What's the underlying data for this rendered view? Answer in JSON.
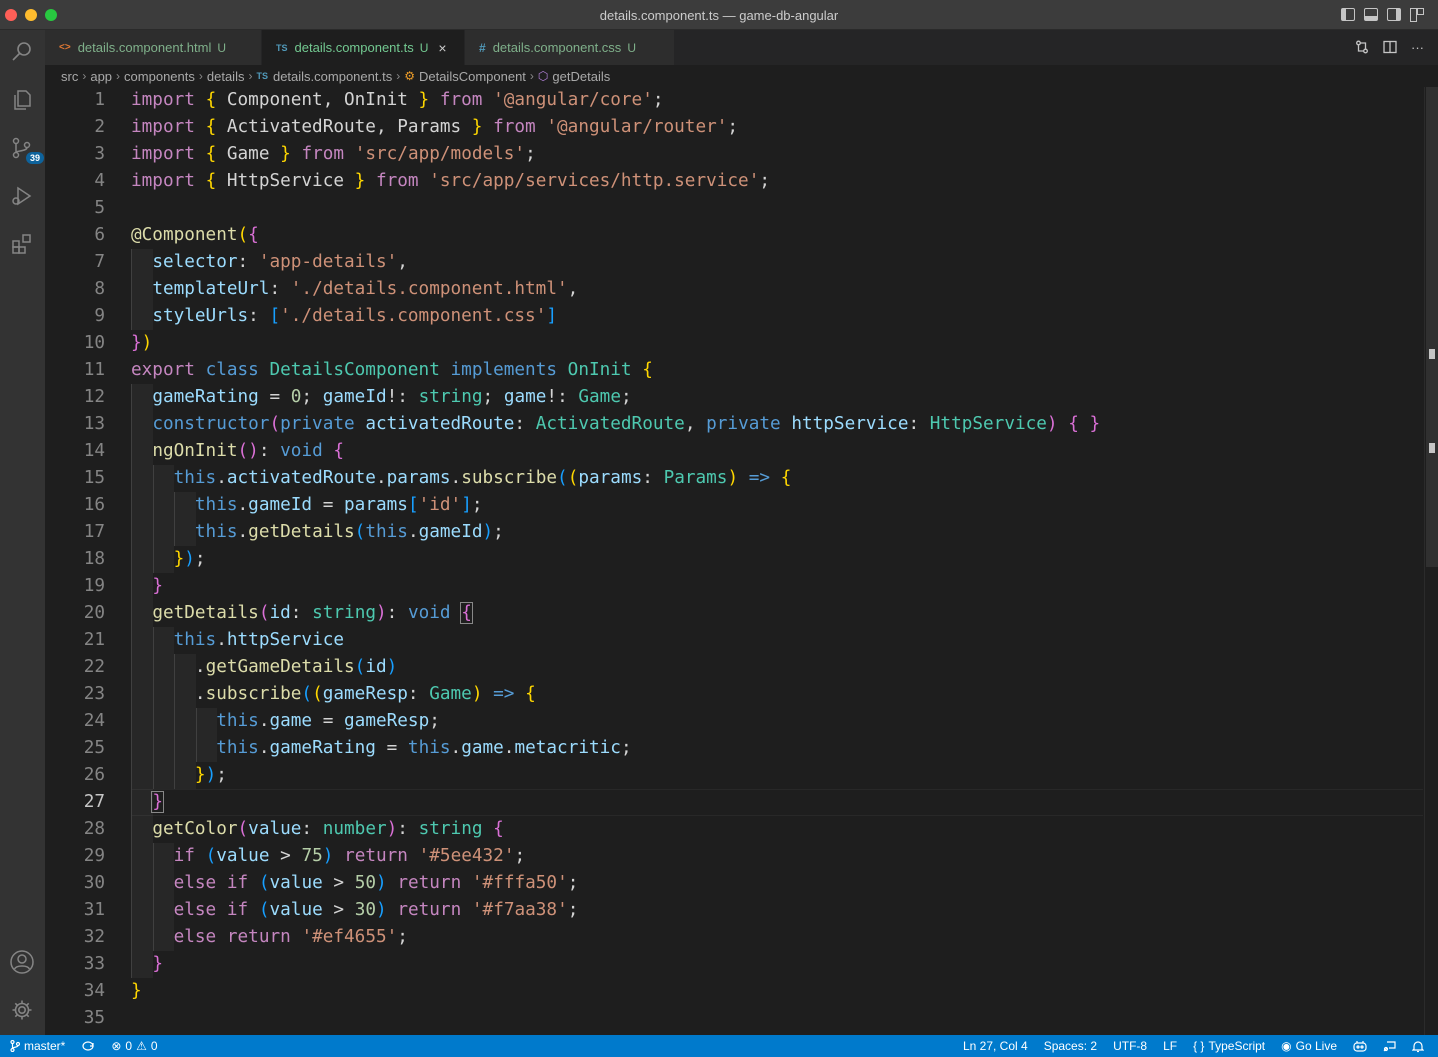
{
  "window": {
    "title": "details.component.ts — game-db-angular"
  },
  "activity": {
    "source_control_badge": "39"
  },
  "tabs": [
    {
      "icon": "<>",
      "label": "details.component.html",
      "status": "U"
    },
    {
      "icon": "TS",
      "label": "details.component.ts",
      "status": "U",
      "close": "×"
    },
    {
      "icon": "#",
      "label": "details.component.css",
      "status": "U"
    }
  ],
  "tab_actions": {
    "more": "···"
  },
  "breadcrumb": {
    "items": [
      "src",
      "app",
      "components",
      "details",
      "details.component.ts",
      "DetailsComponent",
      "getDetails"
    ],
    "ts_icon": "TS"
  },
  "editor": {
    "line_numbers": [
      "1",
      "2",
      "3",
      "4",
      "5",
      "6",
      "7",
      "8",
      "9",
      "10",
      "11",
      "12",
      "13",
      "14",
      "15",
      "16",
      "17",
      "18",
      "19",
      "20",
      "21",
      "22",
      "23",
      "24",
      "25",
      "26",
      "27",
      "28",
      "29",
      "30",
      "31",
      "32",
      "33",
      "34",
      "35"
    ],
    "current_line": "27"
  },
  "statusbar": {
    "branch": "master*",
    "errors": "0",
    "warnings": "0",
    "position": "Ln 27, Col 4",
    "spaces": "Spaces: 2",
    "encoding": "UTF-8",
    "eol": "LF",
    "language": "TypeScript",
    "language_icon": "{ }",
    "golive": "Go Live"
  },
  "code_tokens": [
    [
      "import",
      " ",
      "{",
      " Component, OnInit ",
      "}",
      " ",
      "from",
      " ",
      "'@angular/core'",
      ";"
    ],
    [
      "import",
      " ",
      "{",
      " ActivatedRoute, Params ",
      "}",
      " ",
      "from",
      " ",
      "'@angular/router'",
      ";"
    ],
    [
      "import",
      " ",
      "{",
      " Game ",
      "}",
      " ",
      "from",
      " ",
      "'src/app/models'",
      ";"
    ],
    [
      "import",
      " ",
      "{",
      " HttpService ",
      "}",
      " ",
      "from",
      " ",
      "'src/app/services/http.service'",
      ";"
    ],
    [],
    [
      "@",
      "Component",
      "(",
      "{"
    ],
    [
      "  ",
      "selector",
      ": ",
      "'app-details'",
      ","
    ],
    [
      "  ",
      "templateUrl",
      ": ",
      "'./details.component.html'",
      ","
    ],
    [
      "  ",
      "styleUrls",
      ": ",
      "[",
      "'./details.component.css'",
      "]"
    ],
    [
      "}",
      ")"
    ],
    [
      "export",
      " ",
      "class",
      " ",
      "DetailsComponent",
      " ",
      "implements",
      " ",
      "OnInit",
      " ",
      "{"
    ],
    [
      "  ",
      "gameRating",
      " = ",
      "0",
      "; ",
      "gameId",
      "!: ",
      "string",
      "; ",
      "game",
      "!: ",
      "Game",
      ";"
    ],
    [
      "  ",
      "constructor",
      "(",
      "private",
      " ",
      "activatedRoute",
      ": ",
      "ActivatedRoute",
      ", ",
      "private",
      " ",
      "httpService",
      ": ",
      "HttpService",
      ")",
      " ",
      "{",
      " ",
      "}"
    ],
    [
      "  ",
      "ngOnInit",
      "()",
      ": ",
      "void",
      " ",
      "{"
    ],
    [
      "    ",
      "this",
      ".",
      "activatedRoute",
      ".",
      "params",
      ".",
      "subscribe",
      "(",
      "(",
      "params",
      ": ",
      "Params",
      ")",
      " ",
      "=>",
      " ",
      "{"
    ],
    [
      "      ",
      "this",
      ".",
      "gameId",
      " = ",
      "params",
      "[",
      "'id'",
      "]",
      ";"
    ],
    [
      "      ",
      "this",
      ".",
      "getDetails",
      "(",
      "this",
      ".",
      "gameId",
      ")",
      ";"
    ],
    [
      "    ",
      "}",
      ")",
      ";"
    ],
    [
      "  ",
      "}"
    ],
    [
      "  ",
      "getDetails",
      "(",
      "id",
      ": ",
      "string",
      ")",
      ": ",
      "void",
      " ",
      "{"
    ],
    [
      "    ",
      "this",
      ".",
      "httpService"
    ],
    [
      "      ",
      ".",
      "getGameDetails",
      "(",
      "id",
      ")"
    ],
    [
      "      ",
      ".",
      "subscribe",
      "(",
      "(",
      "gameResp",
      ": ",
      "Game",
      ")",
      " ",
      "=>",
      " ",
      "{"
    ],
    [
      "        ",
      "this",
      ".",
      "game",
      " = ",
      "gameResp",
      ";"
    ],
    [
      "        ",
      "this",
      ".",
      "gameRating",
      " = ",
      "this",
      ".",
      "game",
      ".",
      "metacritic",
      ";"
    ],
    [
      "      ",
      "}",
      ")",
      ";"
    ],
    [
      "  ",
      "}"
    ],
    [
      "  ",
      "getColor",
      "(",
      "value",
      ": ",
      "number",
      ")",
      ": ",
      "string",
      " ",
      "{"
    ],
    [
      "    ",
      "if",
      " ",
      "(",
      "value",
      " > ",
      "75",
      ")",
      " ",
      "return",
      " ",
      "'#5ee432'",
      ";"
    ],
    [
      "    ",
      "else",
      " ",
      "if",
      " ",
      "(",
      "value",
      " > ",
      "50",
      ")",
      " ",
      "return",
      " ",
      "'#fffa50'",
      ";"
    ],
    [
      "    ",
      "else",
      " ",
      "if",
      " ",
      "(",
      "value",
      " > ",
      "30",
      ")",
      " ",
      "return",
      " ",
      "'#f7aa38'",
      ";"
    ],
    [
      "    ",
      "else",
      " ",
      "return",
      " ",
      "'#ef4655'",
      ";"
    ],
    [
      "  ",
      "}"
    ],
    [
      "}"
    ],
    []
  ],
  "code_classes": [
    [
      "k",
      "",
      "b1",
      "",
      "b1",
      "",
      "k",
      "",
      "s",
      ""
    ],
    [
      "k",
      "",
      "b1",
      "",
      "b1",
      "",
      "k",
      "",
      "s",
      ""
    ],
    [
      "k",
      "",
      "b1",
      "",
      "b1",
      "",
      "k",
      "",
      "s",
      ""
    ],
    [
      "k",
      "",
      "b1",
      "",
      "b1",
      "",
      "k",
      "",
      "s",
      ""
    ],
    [],
    [
      "f",
      "f",
      "b1",
      "b2"
    ],
    [
      "",
      "v",
      "",
      "s",
      ""
    ],
    [
      "",
      "v",
      "",
      "s",
      ""
    ],
    [
      "",
      "v",
      "",
      "b3",
      "s",
      "b3"
    ],
    [
      "b2",
      "b1"
    ],
    [
      "k",
      "",
      "kw",
      "",
      "t",
      "",
      "kw",
      "",
      "t",
      "",
      "b1"
    ],
    [
      "",
      "v",
      "",
      "n",
      "",
      "v",
      "",
      "t",
      "",
      "v",
      "",
      "t",
      ""
    ],
    [
      "",
      "kw",
      "b2",
      "kw",
      "",
      "v",
      "",
      "t",
      "",
      "kw",
      "",
      "v",
      "",
      "t",
      "b2",
      "",
      "b2",
      "",
      "b2"
    ],
    [
      "",
      "f",
      "b2",
      "",
      "kw",
      "",
      "b2"
    ],
    [
      "",
      "kw",
      "",
      "v",
      "",
      "v",
      "",
      "f",
      "b3",
      "b1",
      "v",
      "",
      "t",
      "b1",
      "",
      "kw",
      "",
      "b1"
    ],
    [
      "",
      "kw",
      "",
      "v",
      "",
      "v",
      "b3",
      "s",
      "b3",
      ""
    ],
    [
      "",
      "kw",
      "",
      "f",
      "b3",
      "kw",
      "",
      "v",
      "b3",
      ""
    ],
    [
      "",
      "b1",
      "b3",
      ""
    ],
    [
      "",
      "b2"
    ],
    [
      "",
      "f",
      "b2",
      "v",
      "",
      "t",
      "b2",
      "",
      "kw",
      "",
      "b2 bp"
    ],
    [
      "",
      "kw",
      "",
      "v"
    ],
    [
      "",
      "",
      "f",
      "b3",
      "v",
      "b3"
    ],
    [
      "",
      "",
      "f",
      "b3",
      "b1",
      "v",
      "",
      "t",
      "b1",
      "",
      "kw",
      "",
      "b1"
    ],
    [
      "",
      "kw",
      "",
      "v",
      "",
      "v",
      ""
    ],
    [
      "",
      "kw",
      "",
      "v",
      "",
      "kw",
      "",
      "v",
      "",
      "v",
      ""
    ],
    [
      "",
      "b1",
      "b3",
      ""
    ],
    [
      "",
      "b2 bp"
    ],
    [
      "",
      "f",
      "b2",
      "v",
      "",
      "t",
      "b2",
      "",
      "t",
      "",
      "b2"
    ],
    [
      "",
      "k",
      "",
      "b3",
      "v",
      "",
      "n",
      "b3",
      "",
      "k",
      "",
      "s",
      ""
    ],
    [
      "",
      "k",
      "",
      "k",
      "",
      "b3",
      "v",
      "",
      "n",
      "b3",
      "",
      "k",
      "",
      "s",
      ""
    ],
    [
      "",
      "k",
      "",
      "k",
      "",
      "b3",
      "v",
      "",
      "n",
      "b3",
      "",
      "k",
      "",
      "s",
      ""
    ],
    [
      "",
      "k",
      "",
      "k",
      "",
      "s",
      ""
    ],
    [
      "",
      "b2"
    ],
    [
      "b1"
    ],
    []
  ]
}
